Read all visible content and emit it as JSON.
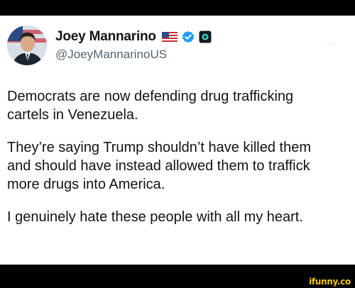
{
  "profile": {
    "display_name": "Joey Mannarino",
    "handle": "@JoeyMannarinoUS",
    "avatar_icon": "profile-photo-icon",
    "badges": [
      "us-flag-icon",
      "verified-badge-icon",
      "affiliate-badge-icon"
    ]
  },
  "tweet": {
    "paragraphs": [
      "Democrats are now defending drug trafficking\ncartels in Venezuela.",
      "They’re saying Trump shouldn’t have killed them\nand should have instead allowed them to traffick\nmore drugs into America.",
      "I genuinely hate these people with all my heart."
    ]
  },
  "watermark": "ifunny.co",
  "colors": {
    "background": "#000000",
    "card": "#ffffff",
    "text": "#0f1419",
    "handle": "#536471",
    "verified": "#1d9bf0",
    "watermark": "#f7c600"
  }
}
